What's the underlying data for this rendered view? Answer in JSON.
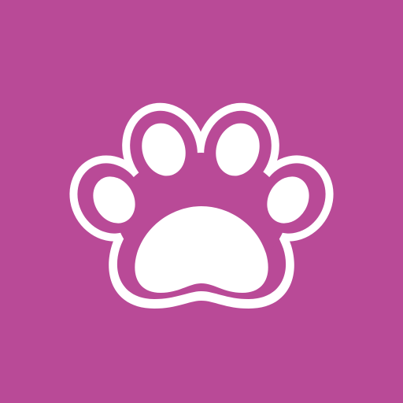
{
  "icon": {
    "name": "paw-icon",
    "background_color": "#B94A97",
    "foreground_color": "#FFFFFF"
  }
}
